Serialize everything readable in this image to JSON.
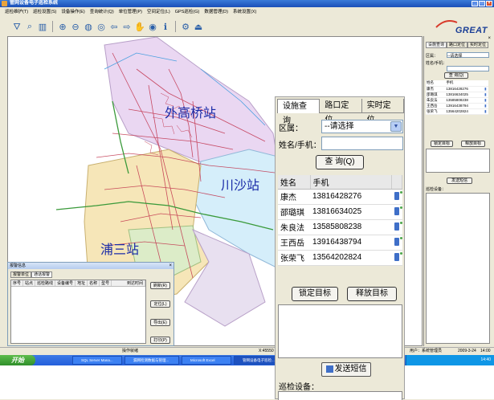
{
  "window": {
    "title": "管网设备电子巡检系统"
  },
  "menu": [
    "巡检维护(T)",
    "巡检设置(S)",
    "设备操作(E)",
    "查询统计(Q)",
    "单位管理(P)",
    "空间定位(L)",
    "GPS巡检(G)",
    "数据管理(D)",
    "系统设置(X)"
  ],
  "toolbar": [
    "flask-icon",
    "zoom-find-icon",
    "chart-icon",
    "zoom-in-icon",
    "zoom-out-icon",
    "globe-icon",
    "full-extent-icon",
    "back-icon",
    "forward-icon",
    "pan-icon",
    "identify-icon",
    "info-icon",
    "settings-icon",
    "exit-icon"
  ],
  "logo": {
    "text": "GREAT"
  },
  "map": {
    "labels": [
      {
        "text": "外高桥站",
        "color": "#1a2ba8"
      },
      {
        "text": "川沙站",
        "color": "#1a2ba8"
      },
      {
        "text": "浦三站",
        "color": "#1a2ba8"
      }
    ],
    "region_colors": {
      "north": "#ead7f2",
      "east": "#d5eefa",
      "south": "#f6e6b8",
      "west": "#ffffff"
    }
  },
  "right_panel": {
    "tabs": [
      "设施查询",
      "路口定位",
      "实时定位"
    ],
    "district_label": "区属：",
    "district_value": "--请选择",
    "name_label": "姓名/手机：",
    "query_button": "查 询(Q)",
    "table_headers": [
      "姓名",
      "手机"
    ],
    "rows": [
      {
        "name": "康杰",
        "phone": "13816428276"
      },
      {
        "name": "邵璐琪",
        "phone": "13816634025"
      },
      {
        "name": "朱良法",
        "phone": "13585808238"
      },
      {
        "name": "王西岳",
        "phone": "13916438794"
      },
      {
        "name": "张荣飞",
        "phone": "13564202824"
      }
    ],
    "lock_button": "锁定目标",
    "release_button": "释放目标",
    "send_button": "发送短信",
    "device_label": "巡检设备："
  },
  "zoom_panel": {
    "tabs": [
      "设施查询",
      "路口定位",
      "实时定位"
    ],
    "district_label": "区属：",
    "district_value": "--请选择",
    "name_label": "姓名/手机：",
    "query_button": "查 询(Q)",
    "table_headers": [
      "姓名",
      "手机"
    ],
    "rows": [
      {
        "name": "康杰",
        "phone": "13816428276"
      },
      {
        "name": "邵璐琪",
        "phone": "13816634025"
      },
      {
        "name": "朱良法",
        "phone": "13585808238"
      },
      {
        "name": "王西岳",
        "phone": "13916438794"
      },
      {
        "name": "张荣飞",
        "phone": "13564202824"
      }
    ],
    "lock_button": "锁定目标",
    "release_button": "释放目标",
    "send_button": "发送短信",
    "device_label": "巡检设备："
  },
  "alarm": {
    "title": "报警信息",
    "tabs": [
      "报警单位",
      "通话报警"
    ],
    "columns": [
      "序号",
      "站点",
      "巡检路线",
      "设备编号",
      "地址",
      "名称",
      "型号",
      "到达时间"
    ],
    "buttons": [
      "刷新(R)",
      "定位(L)",
      "导出(E)",
      "打印(P)"
    ]
  },
  "status": {
    "center": "操作就绪",
    "coord": "X:45550",
    "user": "用户：系统管理员",
    "date": "2009-3-24",
    "time": "14:00"
  },
  "taskbar": {
    "start": "开始",
    "tasks": [
      "SQL Server Mana...",
      "漏网检测数据与管理...",
      "Microsoft Excel",
      "管网设备电子巡检..."
    ],
    "clock": "14:40"
  }
}
